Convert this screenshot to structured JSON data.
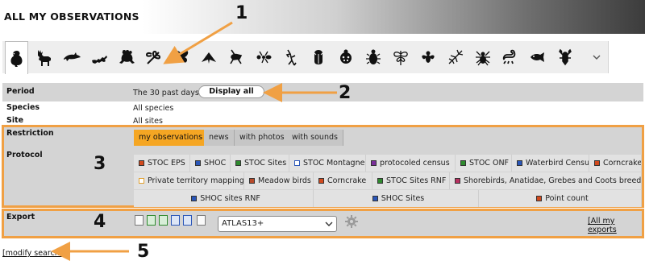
{
  "page": {
    "title": "ALL MY OBSERVATIONS"
  },
  "taxa_bar": {
    "icons": [
      "bird-icon",
      "deer-icon",
      "dolphin-icon",
      "lizard-icon",
      "frog-icon",
      "dragonfly-icon",
      "butterfly-icon",
      "moth-icon",
      "cricket-icon",
      "ant-icon",
      "mantis-icon",
      "cicada-icon",
      "ladybug-icon",
      "beetle-icon",
      "lacewing-icon",
      "fly-icon",
      "stick-insect-icon",
      "spider-icon",
      "scorpion-icon",
      "fish-icon",
      "lobster-icon"
    ],
    "selected": "bird-icon"
  },
  "filters": {
    "period_label": "Period",
    "period_value": "The 30 past days",
    "display_all": "Display all",
    "species_label": "Species",
    "species_value": "All species",
    "site_label": "Site",
    "site_value": "All sites"
  },
  "restriction": {
    "label": "Restriction",
    "tabs": [
      "my observations",
      "news",
      "with photos",
      "with sounds"
    ],
    "active": "my observations"
  },
  "protocol": {
    "label": "Protocol",
    "row1": [
      {
        "label": "STOC EPS",
        "color": "#d24a1e"
      },
      {
        "label": "SHOC",
        "color": "#2a56b8"
      },
      {
        "label": "STOC Sites",
        "color": "#2f8a2f"
      },
      {
        "label": "STOC Montagne",
        "color": "#ffffff"
      },
      {
        "label": "protocoled census",
        "color": "#7a2f9a"
      },
      {
        "label": "STOC ONF",
        "color": "#2f8a2f"
      },
      {
        "label": "Waterbird Census",
        "color": "#2a56b8"
      },
      {
        "label": "Corncrake",
        "color": "#d24a1e"
      }
    ],
    "row2": [
      {
        "label": "Private territory mapping",
        "color": "#ffffff"
      },
      {
        "label": "Meadow birds",
        "color": "#b84a2a"
      },
      {
        "label": "Corncrake",
        "color": "#d24a1e"
      },
      {
        "label": "STOC Sites RNF",
        "color": "#2f8a2f"
      },
      {
        "label": "Shorebirds, Anatidae, Grebes and Coots breeding",
        "color": "#b83060"
      }
    ],
    "row3": [
      {
        "label": "SHOC sites RNF",
        "color": "#2a56b8"
      },
      {
        "label": "SHOC Sites",
        "color": "#2a56b8"
      },
      {
        "label": "Point count",
        "color": "#d24a1e"
      }
    ]
  },
  "export": {
    "label": "Export",
    "format_icons": [
      "document-icon",
      "excel-icon",
      "csv-icon",
      "export-icon",
      "archive-icon",
      "text-file-icon"
    ],
    "selected_format": "ATLAS13+",
    "all_exports_link": "[All my exports"
  },
  "footer": {
    "modify_search": "[modify search]"
  },
  "callouts": [
    "1",
    "2",
    "3",
    "4",
    "5"
  ],
  "colors": {
    "accent_orange": "#f0a044",
    "active_tab": "#f5a623",
    "panel_grey": "#d4d4d4"
  }
}
